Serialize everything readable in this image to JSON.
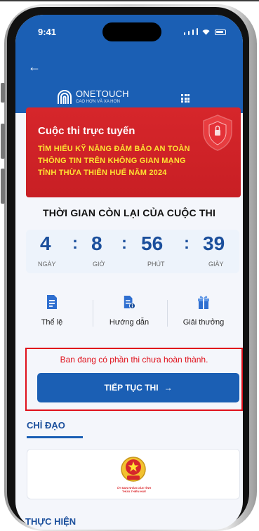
{
  "status_bar": {
    "time": "9:41"
  },
  "app_bar": {
    "back_icon": "arrow-left-icon"
  },
  "brand": {
    "logo_title": "ONETOUCH",
    "logo_subtitle": "CAO HƠN VÀ XA HƠN",
    "menu_icon": "grid-menu-icon"
  },
  "banner": {
    "kicker": "Cuộc thi trực tuyến",
    "title_lines": [
      "TÌM HIỂU KỸ NĂNG ĐẢM BẢO AN TOÀN",
      "THÔNG TIN TRÊN KHÔNG GIAN MẠNG",
      "TỈNH THỪA THIÊN HUẾ NĂM 2024"
    ],
    "accent": "#d6262b",
    "title_color": "#ffe232"
  },
  "countdown": {
    "heading": "THỜI GIAN CÒN LẠI CỦA CUỘC THI",
    "days": "4",
    "days_label": "NGÀY",
    "hours": "8",
    "hours_label": "GIỜ",
    "minutes": "56",
    "minutes_label": "PHÚT",
    "seconds": "39",
    "seconds_label": "GIÂY"
  },
  "actions": [
    {
      "label": "Thể lệ",
      "icon": "document-icon"
    },
    {
      "label": "Hướng dẫn",
      "icon": "document-info-icon"
    },
    {
      "label": "Giải thưởng",
      "icon": "gift-icon"
    }
  ],
  "notice": {
    "text": "Ban đang có phần thi chưa hoàn thành.",
    "button_label": "TIẾP TỤC THI",
    "button_icon": "arrow-right-icon",
    "border_color": "#e0101b"
  },
  "section_direction": {
    "heading": "CHỈ ĐẠO",
    "org_lines": [
      "ỦY BAN NHÂN DÂN TỈNH",
      "THỪA THIÊN HUẾ"
    ],
    "emblem_icon": "national-emblem-icon"
  },
  "section_execution": {
    "heading": "THỰC HIỆN"
  },
  "colors": {
    "primary": "#1b5fb4",
    "heading_blue": "#1b4f9c"
  }
}
